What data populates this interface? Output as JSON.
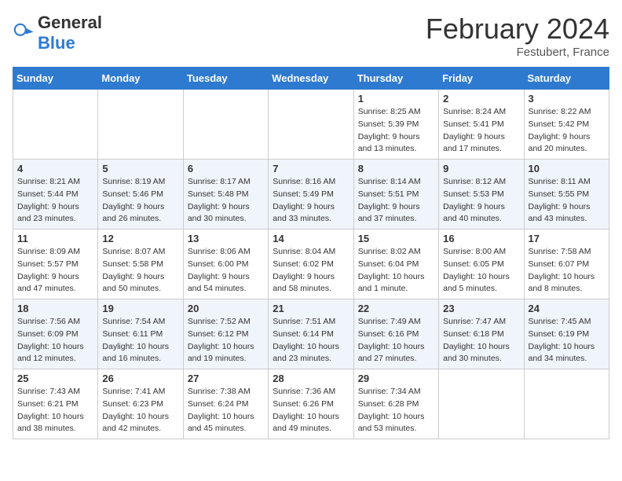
{
  "header": {
    "logo_general": "General",
    "logo_blue": "Blue",
    "month_title": "February 2024",
    "location": "Festubert, France"
  },
  "weekdays": [
    "Sunday",
    "Monday",
    "Tuesday",
    "Wednesday",
    "Thursday",
    "Friday",
    "Saturday"
  ],
  "weeks": [
    [
      {
        "day": "",
        "info": ""
      },
      {
        "day": "",
        "info": ""
      },
      {
        "day": "",
        "info": ""
      },
      {
        "day": "",
        "info": ""
      },
      {
        "day": "1",
        "info": "Sunrise: 8:25 AM\nSunset: 5:39 PM\nDaylight: 9 hours\nand 13 minutes."
      },
      {
        "day": "2",
        "info": "Sunrise: 8:24 AM\nSunset: 5:41 PM\nDaylight: 9 hours\nand 17 minutes."
      },
      {
        "day": "3",
        "info": "Sunrise: 8:22 AM\nSunset: 5:42 PM\nDaylight: 9 hours\nand 20 minutes."
      }
    ],
    [
      {
        "day": "4",
        "info": "Sunrise: 8:21 AM\nSunset: 5:44 PM\nDaylight: 9 hours\nand 23 minutes."
      },
      {
        "day": "5",
        "info": "Sunrise: 8:19 AM\nSunset: 5:46 PM\nDaylight: 9 hours\nand 26 minutes."
      },
      {
        "day": "6",
        "info": "Sunrise: 8:17 AM\nSunset: 5:48 PM\nDaylight: 9 hours\nand 30 minutes."
      },
      {
        "day": "7",
        "info": "Sunrise: 8:16 AM\nSunset: 5:49 PM\nDaylight: 9 hours\nand 33 minutes."
      },
      {
        "day": "8",
        "info": "Sunrise: 8:14 AM\nSunset: 5:51 PM\nDaylight: 9 hours\nand 37 minutes."
      },
      {
        "day": "9",
        "info": "Sunrise: 8:12 AM\nSunset: 5:53 PM\nDaylight: 9 hours\nand 40 minutes."
      },
      {
        "day": "10",
        "info": "Sunrise: 8:11 AM\nSunset: 5:55 PM\nDaylight: 9 hours\nand 43 minutes."
      }
    ],
    [
      {
        "day": "11",
        "info": "Sunrise: 8:09 AM\nSunset: 5:57 PM\nDaylight: 9 hours\nand 47 minutes."
      },
      {
        "day": "12",
        "info": "Sunrise: 8:07 AM\nSunset: 5:58 PM\nDaylight: 9 hours\nand 50 minutes."
      },
      {
        "day": "13",
        "info": "Sunrise: 8:06 AM\nSunset: 6:00 PM\nDaylight: 9 hours\nand 54 minutes."
      },
      {
        "day": "14",
        "info": "Sunrise: 8:04 AM\nSunset: 6:02 PM\nDaylight: 9 hours\nand 58 minutes."
      },
      {
        "day": "15",
        "info": "Sunrise: 8:02 AM\nSunset: 6:04 PM\nDaylight: 10 hours\nand 1 minute."
      },
      {
        "day": "16",
        "info": "Sunrise: 8:00 AM\nSunset: 6:05 PM\nDaylight: 10 hours\nand 5 minutes."
      },
      {
        "day": "17",
        "info": "Sunrise: 7:58 AM\nSunset: 6:07 PM\nDaylight: 10 hours\nand 8 minutes."
      }
    ],
    [
      {
        "day": "18",
        "info": "Sunrise: 7:56 AM\nSunset: 6:09 PM\nDaylight: 10 hours\nand 12 minutes."
      },
      {
        "day": "19",
        "info": "Sunrise: 7:54 AM\nSunset: 6:11 PM\nDaylight: 10 hours\nand 16 minutes."
      },
      {
        "day": "20",
        "info": "Sunrise: 7:52 AM\nSunset: 6:12 PM\nDaylight: 10 hours\nand 19 minutes."
      },
      {
        "day": "21",
        "info": "Sunrise: 7:51 AM\nSunset: 6:14 PM\nDaylight: 10 hours\nand 23 minutes."
      },
      {
        "day": "22",
        "info": "Sunrise: 7:49 AM\nSunset: 6:16 PM\nDaylight: 10 hours\nand 27 minutes."
      },
      {
        "day": "23",
        "info": "Sunrise: 7:47 AM\nSunset: 6:18 PM\nDaylight: 10 hours\nand 30 minutes."
      },
      {
        "day": "24",
        "info": "Sunrise: 7:45 AM\nSunset: 6:19 PM\nDaylight: 10 hours\nand 34 minutes."
      }
    ],
    [
      {
        "day": "25",
        "info": "Sunrise: 7:43 AM\nSunset: 6:21 PM\nDaylight: 10 hours\nand 38 minutes."
      },
      {
        "day": "26",
        "info": "Sunrise: 7:41 AM\nSunset: 6:23 PM\nDaylight: 10 hours\nand 42 minutes."
      },
      {
        "day": "27",
        "info": "Sunrise: 7:38 AM\nSunset: 6:24 PM\nDaylight: 10 hours\nand 45 minutes."
      },
      {
        "day": "28",
        "info": "Sunrise: 7:36 AM\nSunset: 6:26 PM\nDaylight: 10 hours\nand 49 minutes."
      },
      {
        "day": "29",
        "info": "Sunrise: 7:34 AM\nSunset: 6:28 PM\nDaylight: 10 hours\nand 53 minutes."
      },
      {
        "day": "",
        "info": ""
      },
      {
        "day": "",
        "info": ""
      }
    ]
  ]
}
